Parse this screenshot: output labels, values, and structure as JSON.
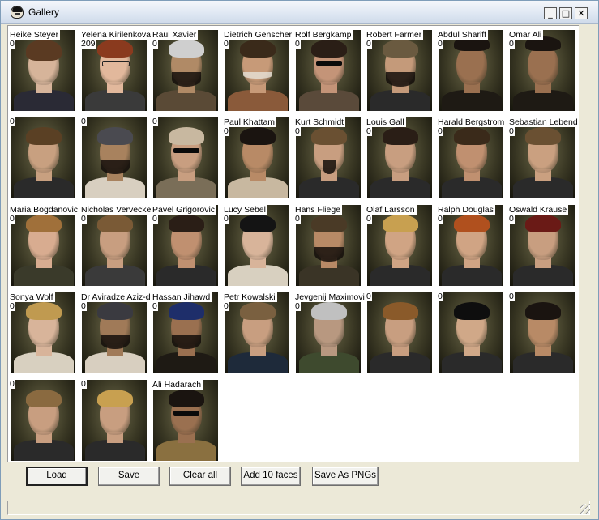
{
  "window": {
    "title": "Gallery",
    "minimize": "_",
    "maximize": "□",
    "close": "✕",
    "app_icon": "face-icon"
  },
  "gallery": {
    "faces": [
      {
        "name": "Heike Steyer",
        "value": "0",
        "skin": "#d6b49a",
        "hair": "#5a3a22",
        "clothes": "#2a2a35",
        "extra": "headband"
      },
      {
        "name": "Yelena Kirilenkova",
        "value": "209",
        "skin": "#e2b89c",
        "hair": "#8a3a1e",
        "clothes": "#3a3a3a",
        "extra": "glasses"
      },
      {
        "name": "Raul Xavier",
        "value": "0",
        "skin": "#b08a66",
        "hair": "#cfcfcf",
        "clothes": "#5a4a36",
        "extra": "beard"
      },
      {
        "name": "Dietrich Genscher",
        "value": "0",
        "skin": "#c79a78",
        "hair": "#3a2a1a",
        "clothes": "#8a5a3a",
        "extra": "mustache"
      },
      {
        "name": "Rolf Bergkamp",
        "value": "0",
        "skin": "#c49478",
        "hair": "#2a1e16",
        "clothes": "#5a4a3a",
        "extra": "shades"
      },
      {
        "name": "Robert Farmer",
        "value": "0",
        "skin": "#c49a7a",
        "hair": "#6a5a40",
        "clothes": "#2a2a2a",
        "extra": "beard"
      },
      {
        "name": "Abdul Shariff",
        "value": "0",
        "skin": "#9a7050",
        "hair": "#1a1410",
        "clothes": "#1e1a14",
        "extra": "turban"
      },
      {
        "name": "Omar Ali",
        "value": "0",
        "skin": "#9a7050",
        "hair": "#1a1410",
        "clothes": "#1e1a14",
        "extra": "turban"
      },
      {
        "name": "",
        "value": "0",
        "skin": "#c8a080",
        "hair": "#5a4024",
        "clothes": "#2a2a2a",
        "extra": ""
      },
      {
        "name": "",
        "value": "0",
        "skin": "#a8825e",
        "hair": "#4a4a50",
        "clothes": "#d8cfc0",
        "extra": "beard"
      },
      {
        "name": "",
        "value": "0",
        "skin": "#c89e80",
        "hair": "#c8b8a0",
        "clothes": "#7a6e58",
        "extra": "shades"
      },
      {
        "name": "Paul Khattam",
        "value": "0",
        "skin": "#b88a66",
        "hair": "#1a1410",
        "clothes": "#c8b8a0",
        "extra": ""
      },
      {
        "name": "Kurt Schmidt",
        "value": "0",
        "skin": "#c89e80",
        "hair": "#6a5032",
        "clothes": "#2a2a2a",
        "extra": "goatee"
      },
      {
        "name": "Louis Gall",
        "value": "0",
        "skin": "#c89e80",
        "hair": "#2a1e16",
        "clothes": "#2a2a2a",
        "extra": ""
      },
      {
        "name": "Harald Bergstrom",
        "value": "0",
        "skin": "#c09070",
        "hair": "#3a2a1a",
        "clothes": "#2a2a2a",
        "extra": ""
      },
      {
        "name": "Sebastian Lebend",
        "value": "0",
        "skin": "#caa080",
        "hair": "#6a5032",
        "clothes": "#2a2a2a",
        "extra": ""
      },
      {
        "name": "Maria Bogdanovic",
        "value": "0",
        "skin": "#d8ac90",
        "hair": "#a0703a",
        "clothes": "#3a3a2a",
        "extra": ""
      },
      {
        "name": "Nicholas Vervecke",
        "value": "0",
        "skin": "#c89e80",
        "hair": "#7a5a36",
        "clothes": "#3a3a3a",
        "extra": ""
      },
      {
        "name": "Pavel Grigorovic",
        "value": "0",
        "skin": "#c09070",
        "hair": "#2a1e16",
        "clothes": "#2a2a2a",
        "extra": ""
      },
      {
        "name": "Lucy Sebel",
        "value": "0",
        "skin": "#d8b49a",
        "hair": "#141414",
        "clothes": "#d8d0c0",
        "extra": ""
      },
      {
        "name": "Hans Fliege",
        "value": "0",
        "skin": "#b88a66",
        "hair": "#4a3a26",
        "clothes": "#3a3426",
        "extra": "beard"
      },
      {
        "name": "Olaf Larsson",
        "value": "0",
        "skin": "#d0a484",
        "hair": "#c8a050",
        "clothes": "#2a2a2a",
        "extra": ""
      },
      {
        "name": "Ralph Douglas",
        "value": "0",
        "skin": "#d0a484",
        "hair": "#b0501e",
        "clothes": "#2a2a2a",
        "extra": ""
      },
      {
        "name": "Oswald Krause",
        "value": "0",
        "skin": "#c89e80",
        "hair": "#6a1a16",
        "clothes": "#2a2a2a",
        "extra": ""
      },
      {
        "name": "Sonya Wolf",
        "value": "0",
        "skin": "#d8b49a",
        "hair": "#c09a50",
        "clothes": "#d8d0c0",
        "extra": ""
      },
      {
        "name": "Dr Aviradze Aziz-di",
        "value": "0",
        "skin": "#a07a58",
        "hair": "#3a3a40",
        "clothes": "#d8cfc0",
        "extra": "beard"
      },
      {
        "name": "Hassan Jihawd",
        "value": "0",
        "skin": "#9a7050",
        "hair": "#1e2e6a",
        "clothes": "#1e1a14",
        "extra": "beard"
      },
      {
        "name": "Petr Kowalski",
        "value": "0",
        "skin": "#c89e80",
        "hair": "#7a6040",
        "clothes": "#1e2a3a",
        "extra": ""
      },
      {
        "name": "Jevgenij Maximovi",
        "value": "0",
        "skin": "#b89880",
        "hair": "#c0c0c0",
        "clothes": "#3e4a2e",
        "extra": ""
      },
      {
        "name": "",
        "value": "0",
        "skin": "#c89e80",
        "hair": "#8a5a2a",
        "clothes": "#2a2a2a",
        "extra": ""
      },
      {
        "name": "",
        "value": "0",
        "skin": "#d0a888",
        "hair": "#0e0e0e",
        "clothes": "#2a2a2a",
        "extra": ""
      },
      {
        "name": "",
        "value": "0",
        "skin": "#b88a66",
        "hair": "#1a1410",
        "clothes": "#2a2a2a",
        "extra": ""
      },
      {
        "name": "",
        "value": "0",
        "skin": "#c89e80",
        "hair": "#8a6a40",
        "clothes": "#2a2a2a",
        "extra": ""
      },
      {
        "name": "",
        "value": "0",
        "skin": "#c89e80",
        "hair": "#c8a050",
        "clothes": "#2a2a2a",
        "extra": ""
      },
      {
        "name": "Ali Hadarach",
        "value": "",
        "skin": "#9a7050",
        "hair": "#1a1410",
        "clothes": "#8a7040",
        "extra": "shades"
      }
    ]
  },
  "buttons": {
    "load": "Load",
    "save": "Save",
    "clear_all": "Clear all",
    "add_10_faces": "Add 10 faces",
    "save_as_pngs": "Save As PNGs"
  },
  "status_bar": {
    "text": ""
  }
}
